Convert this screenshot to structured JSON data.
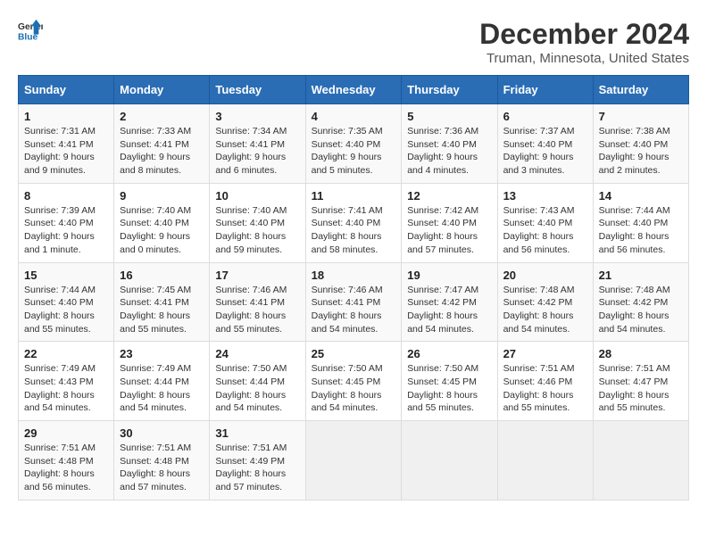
{
  "header": {
    "logo_line1": "General",
    "logo_line2": "Blue",
    "main_title": "December 2024",
    "subtitle": "Truman, Minnesota, United States"
  },
  "days_of_week": [
    "Sunday",
    "Monday",
    "Tuesday",
    "Wednesday",
    "Thursday",
    "Friday",
    "Saturday"
  ],
  "weeks": [
    [
      {
        "day": "1",
        "sunrise": "7:31 AM",
        "sunset": "4:41 PM",
        "daylight": "9 hours and 9 minutes."
      },
      {
        "day": "2",
        "sunrise": "7:33 AM",
        "sunset": "4:41 PM",
        "daylight": "9 hours and 8 minutes."
      },
      {
        "day": "3",
        "sunrise": "7:34 AM",
        "sunset": "4:41 PM",
        "daylight": "9 hours and 6 minutes."
      },
      {
        "day": "4",
        "sunrise": "7:35 AM",
        "sunset": "4:40 PM",
        "daylight": "9 hours and 5 minutes."
      },
      {
        "day": "5",
        "sunrise": "7:36 AM",
        "sunset": "4:40 PM",
        "daylight": "9 hours and 4 minutes."
      },
      {
        "day": "6",
        "sunrise": "7:37 AM",
        "sunset": "4:40 PM",
        "daylight": "9 hours and 3 minutes."
      },
      {
        "day": "7",
        "sunrise": "7:38 AM",
        "sunset": "4:40 PM",
        "daylight": "9 hours and 2 minutes."
      }
    ],
    [
      {
        "day": "8",
        "sunrise": "7:39 AM",
        "sunset": "4:40 PM",
        "daylight": "9 hours and 1 minute."
      },
      {
        "day": "9",
        "sunrise": "7:40 AM",
        "sunset": "4:40 PM",
        "daylight": "9 hours and 0 minutes."
      },
      {
        "day": "10",
        "sunrise": "7:40 AM",
        "sunset": "4:40 PM",
        "daylight": "8 hours and 59 minutes."
      },
      {
        "day": "11",
        "sunrise": "7:41 AM",
        "sunset": "4:40 PM",
        "daylight": "8 hours and 58 minutes."
      },
      {
        "day": "12",
        "sunrise": "7:42 AM",
        "sunset": "4:40 PM",
        "daylight": "8 hours and 57 minutes."
      },
      {
        "day": "13",
        "sunrise": "7:43 AM",
        "sunset": "4:40 PM",
        "daylight": "8 hours and 56 minutes."
      },
      {
        "day": "14",
        "sunrise": "7:44 AM",
        "sunset": "4:40 PM",
        "daylight": "8 hours and 56 minutes."
      }
    ],
    [
      {
        "day": "15",
        "sunrise": "7:44 AM",
        "sunset": "4:40 PM",
        "daylight": "8 hours and 55 minutes."
      },
      {
        "day": "16",
        "sunrise": "7:45 AM",
        "sunset": "4:41 PM",
        "daylight": "8 hours and 55 minutes."
      },
      {
        "day": "17",
        "sunrise": "7:46 AM",
        "sunset": "4:41 PM",
        "daylight": "8 hours and 55 minutes."
      },
      {
        "day": "18",
        "sunrise": "7:46 AM",
        "sunset": "4:41 PM",
        "daylight": "8 hours and 54 minutes."
      },
      {
        "day": "19",
        "sunrise": "7:47 AM",
        "sunset": "4:42 PM",
        "daylight": "8 hours and 54 minutes."
      },
      {
        "day": "20",
        "sunrise": "7:48 AM",
        "sunset": "4:42 PM",
        "daylight": "8 hours and 54 minutes."
      },
      {
        "day": "21",
        "sunrise": "7:48 AM",
        "sunset": "4:42 PM",
        "daylight": "8 hours and 54 minutes."
      }
    ],
    [
      {
        "day": "22",
        "sunrise": "7:49 AM",
        "sunset": "4:43 PM",
        "daylight": "8 hours and 54 minutes."
      },
      {
        "day": "23",
        "sunrise": "7:49 AM",
        "sunset": "4:44 PM",
        "daylight": "8 hours and 54 minutes."
      },
      {
        "day": "24",
        "sunrise": "7:50 AM",
        "sunset": "4:44 PM",
        "daylight": "8 hours and 54 minutes."
      },
      {
        "day": "25",
        "sunrise": "7:50 AM",
        "sunset": "4:45 PM",
        "daylight": "8 hours and 54 minutes."
      },
      {
        "day": "26",
        "sunrise": "7:50 AM",
        "sunset": "4:45 PM",
        "daylight": "8 hours and 55 minutes."
      },
      {
        "day": "27",
        "sunrise": "7:51 AM",
        "sunset": "4:46 PM",
        "daylight": "8 hours and 55 minutes."
      },
      {
        "day": "28",
        "sunrise": "7:51 AM",
        "sunset": "4:47 PM",
        "daylight": "8 hours and 55 minutes."
      }
    ],
    [
      {
        "day": "29",
        "sunrise": "7:51 AM",
        "sunset": "4:48 PM",
        "daylight": "8 hours and 56 minutes."
      },
      {
        "day": "30",
        "sunrise": "7:51 AM",
        "sunset": "4:48 PM",
        "daylight": "8 hours and 57 minutes."
      },
      {
        "day": "31",
        "sunrise": "7:51 AM",
        "sunset": "4:49 PM",
        "daylight": "8 hours and 57 minutes."
      },
      null,
      null,
      null,
      null
    ]
  ]
}
